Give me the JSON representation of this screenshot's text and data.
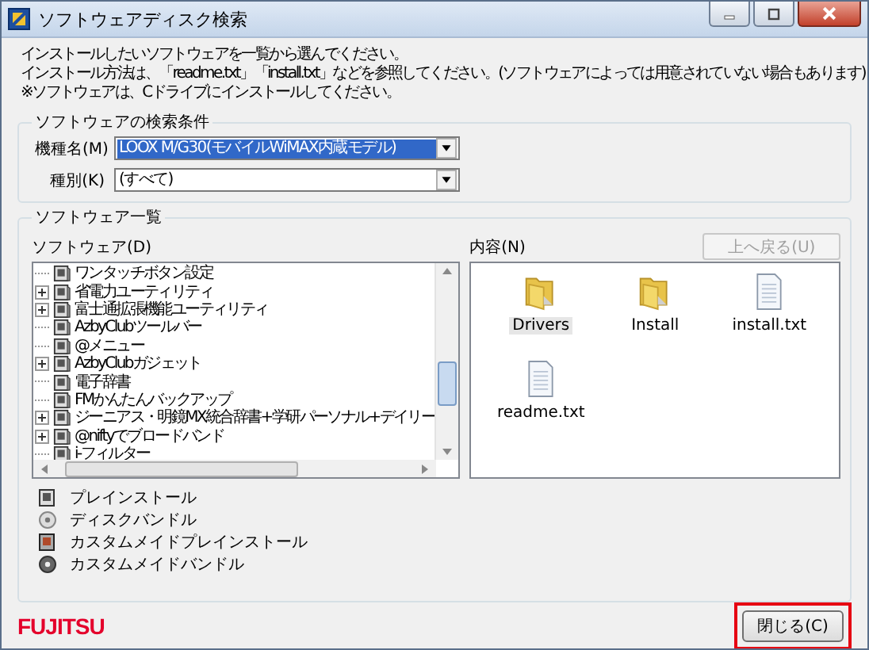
{
  "window": {
    "title": "ソフトウェアディスク検索"
  },
  "instructions": [
    "インストールしたいソフトウェアを一覧から選んでください。",
    "インストール方法は、「readme.txt」「install.txt」などを参照してください。(ソフトウェアによっては用意されていない場合もあります)",
    "※ソフトウェアは、Cドライブにインストールしてください。"
  ],
  "search": {
    "title": "ソフトウェアの検索条件",
    "fields": [
      {
        "label": "機種名(M)",
        "value": "LOOX M/G30(モバイルWiMAX内蔵モデル)",
        "highlighted": true
      },
      {
        "label": "種別(K)",
        "value": "(すべて)",
        "highlighted": false
      }
    ]
  },
  "software": {
    "title": "ソフトウェア一覧",
    "tree_label": "ソフトウェア(D)",
    "content_label": "内容(N)",
    "up_button": {
      "label": "上へ戻る(U)",
      "disabled": true
    },
    "tree": [
      {
        "label": "ワンタッチボタン設定",
        "expandable": false
      },
      {
        "label": "省電力ユーティリティ",
        "expandable": true
      },
      {
        "label": "富士通拡張機能ユーティリティ",
        "expandable": true
      },
      {
        "label": "AzbyClubツールバー",
        "expandable": false
      },
      {
        "label": "@メニュー",
        "expandable": false
      },
      {
        "label": "AzbyClubガジェット",
        "expandable": true
      },
      {
        "label": "電子辞書",
        "expandable": false
      },
      {
        "label": "FMかんたんバックアップ",
        "expandable": false
      },
      {
        "label": "ジーニアス・明鏡MX統合辞書+学研パーソナル+デイリー",
        "expandable": true
      },
      {
        "label": "@niftyでブロードバンド",
        "expandable": true
      },
      {
        "label": "i-フィルター",
        "expandable": false
      }
    ],
    "files": [
      {
        "name": "Drivers",
        "kind": "folder",
        "selected": true
      },
      {
        "name": "Install",
        "kind": "folder",
        "selected": false
      },
      {
        "name": "install.txt",
        "kind": "file",
        "selected": false
      },
      {
        "name": "readme.txt",
        "kind": "file",
        "selected": false
      }
    ],
    "legend": [
      {
        "label": "プレインストール",
        "kind": "preinstall"
      },
      {
        "label": "ディスクバンドル",
        "kind": "bundle"
      },
      {
        "label": "カスタムメイドプレインストール",
        "kind": "custom-preinstall"
      },
      {
        "label": "カスタムメイドバンドル",
        "kind": "custom-bundle"
      }
    ]
  },
  "footer": {
    "logo": "FUJITSU",
    "close_button": {
      "label": "閉じる(C)",
      "highlighted": true
    }
  }
}
